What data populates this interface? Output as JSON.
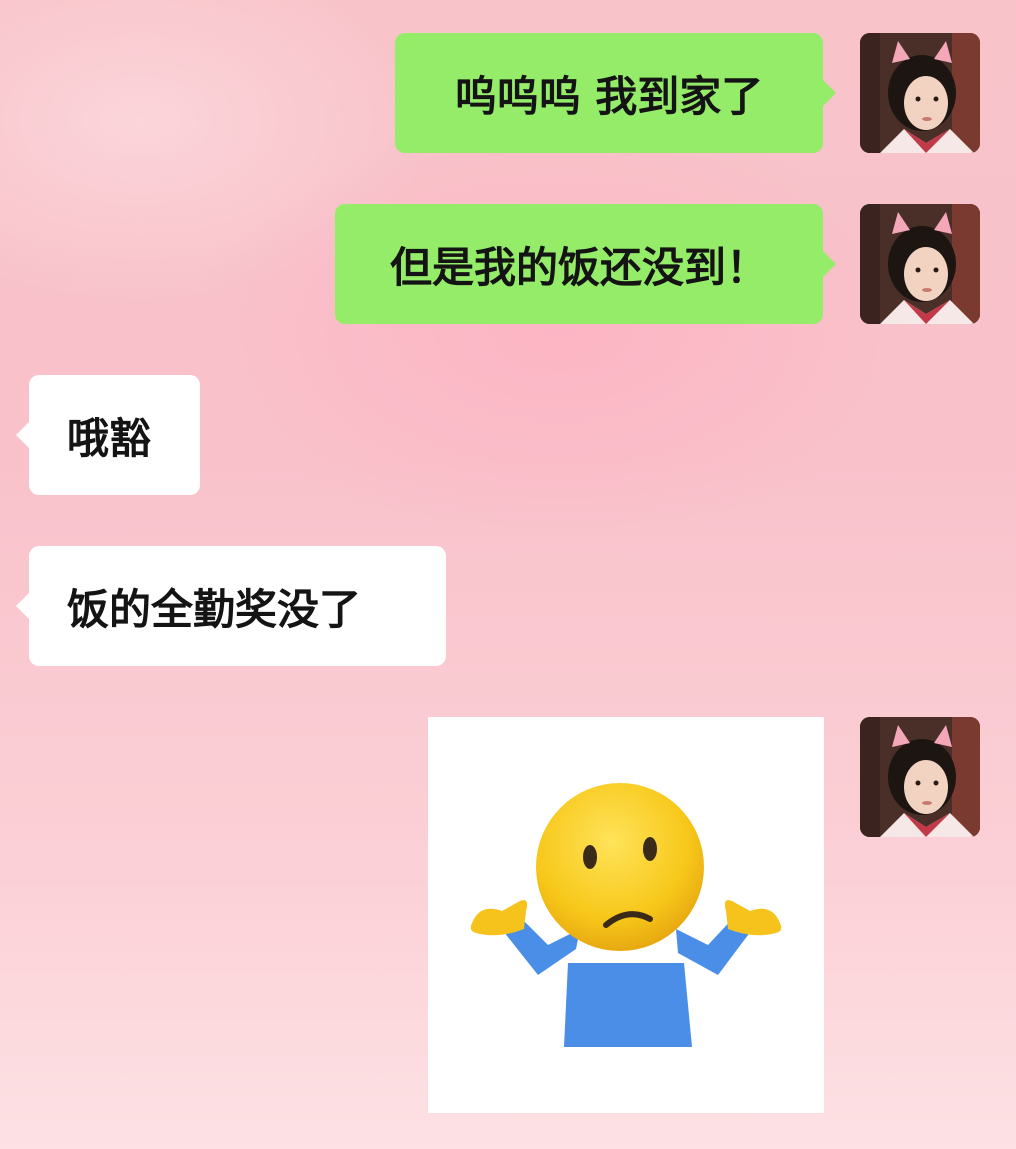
{
  "messages": [
    {
      "side": "sent",
      "text": "呜呜呜 我到家了"
    },
    {
      "side": "sent",
      "text": "但是我的饭还没到！"
    },
    {
      "side": "recv",
      "text": "哦豁"
    },
    {
      "side": "recv",
      "text": "饭的全勤奖没了"
    },
    {
      "side": "sent",
      "type": "sticker",
      "sticker": "shrug-emoji"
    }
  ],
  "colors": {
    "sent_bubble": "#95ec69",
    "recv_bubble": "#ffffff",
    "background": "#f9c2cb"
  }
}
